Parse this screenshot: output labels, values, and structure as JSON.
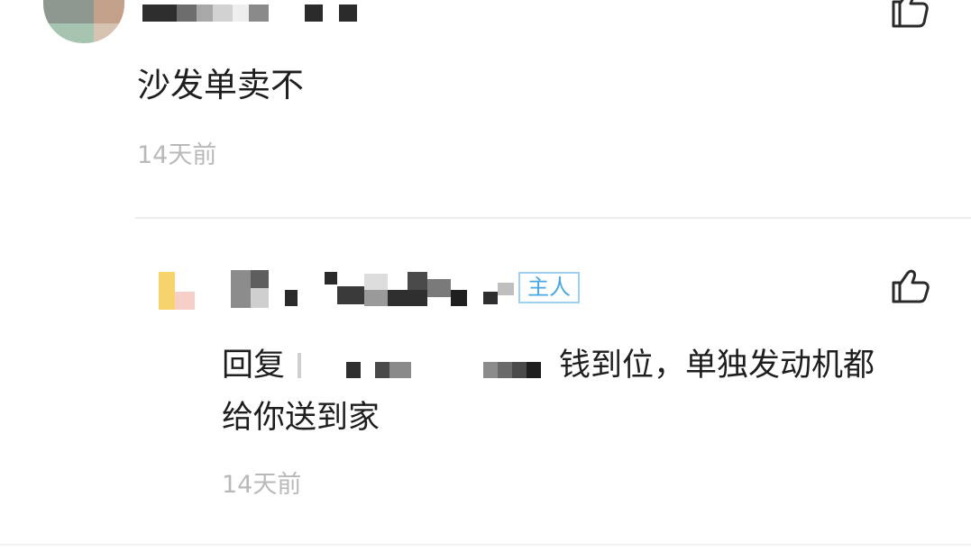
{
  "comment": {
    "text": "沙发单卖不",
    "time": "14天前"
  },
  "reply": {
    "badge": "主人",
    "prefix": "回复",
    "text_after_mention": "钱到位，单独发动机都",
    "text_line2": "给你送到家",
    "time": "14天前"
  },
  "icons": {
    "like": "thumbs-up-icon"
  },
  "colors": {
    "badge_border": "#9ed0f1",
    "badge_text": "#4aa7e6",
    "timestamp": "#b9b9b9",
    "body_text": "#1e1e1e"
  }
}
